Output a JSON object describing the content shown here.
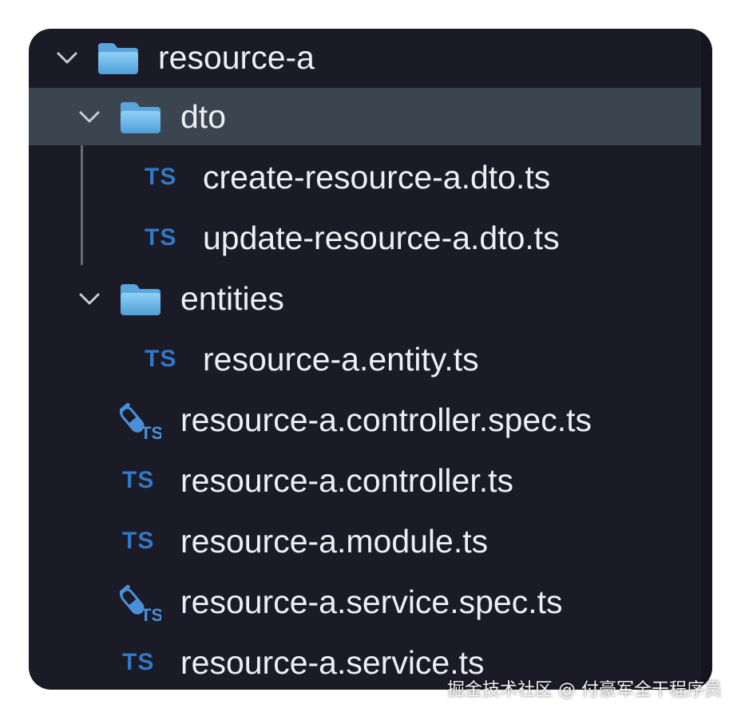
{
  "tree": {
    "root": {
      "label": "resource-a",
      "expanded": true
    },
    "dto": {
      "label": "dto",
      "expanded": true,
      "files": [
        {
          "type": "TS",
          "label": "create-resource-a.dto.ts"
        },
        {
          "type": "TS",
          "label": "update-resource-a.dto.ts"
        }
      ]
    },
    "entities": {
      "label": "entities",
      "expanded": true,
      "files": [
        {
          "type": "TS",
          "label": "resource-a.entity.ts"
        }
      ]
    },
    "files": [
      {
        "type": "spec",
        "label": "resource-a.controller.spec.ts"
      },
      {
        "type": "TS",
        "label": "resource-a.controller.ts"
      },
      {
        "type": "TS",
        "label": "resource-a.module.ts"
      },
      {
        "type": "spec",
        "label": "resource-a.service.spec.ts"
      },
      {
        "type": "TS",
        "label": "resource-a.service.ts"
      }
    ]
  },
  "icons": {
    "ts_badge": "TS",
    "folder": "folder-icon",
    "chevron": "chevron-down-icon",
    "spec": "test-tube-icon"
  },
  "colors": {
    "background": "#1b1a27",
    "selected_row": "#3a4550",
    "ts_blue": "#3178c6",
    "folder_blue": "#6cb6e8",
    "text": "#eceff4"
  },
  "watermark": "掘金技术社区 @ 付豪军全干程序员"
}
